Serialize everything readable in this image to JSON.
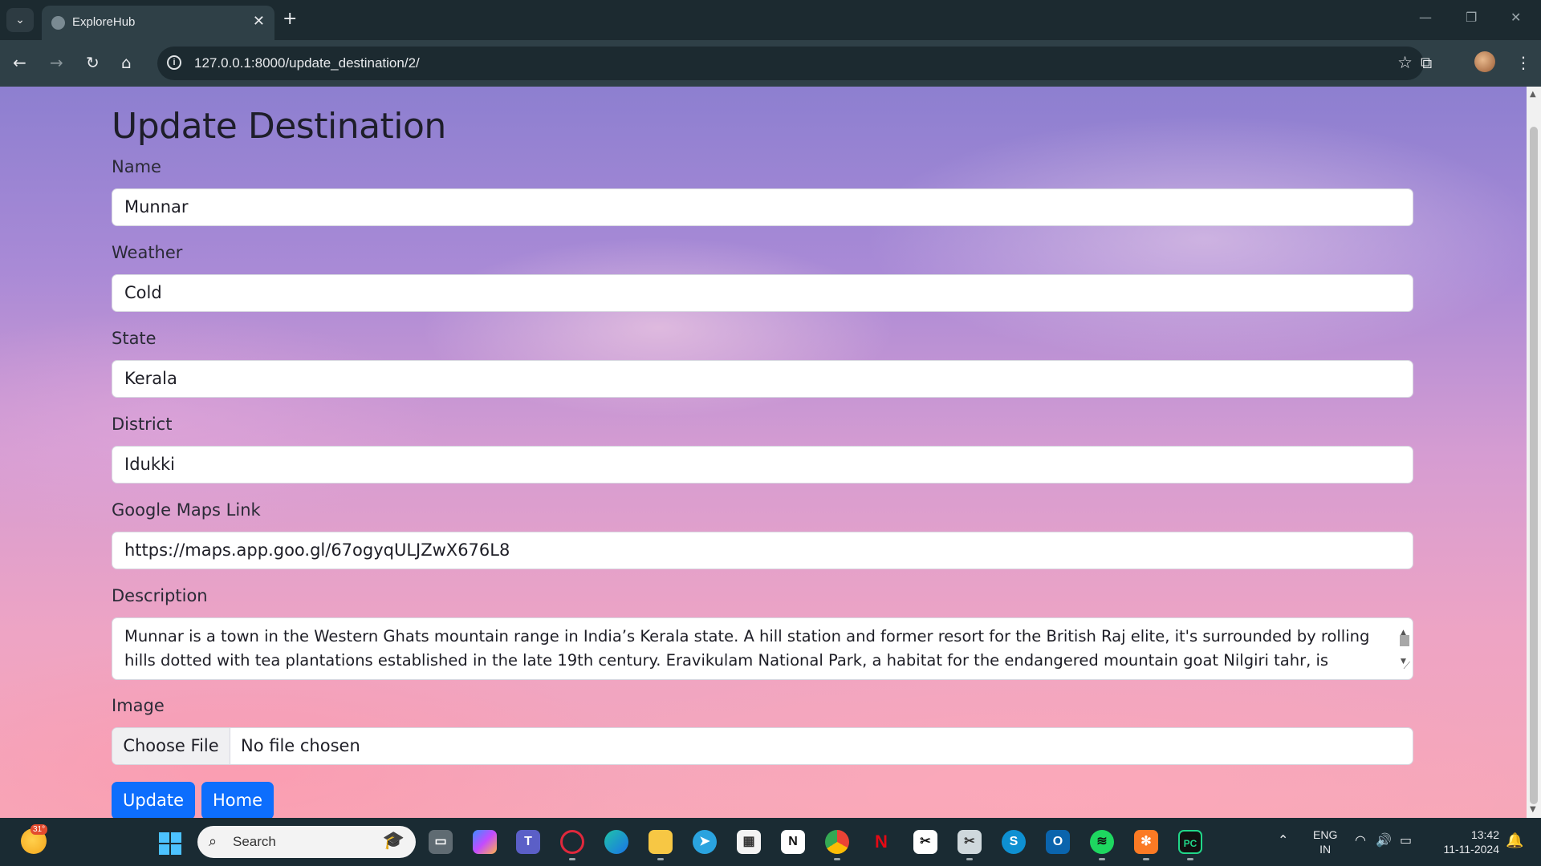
{
  "browser": {
    "tab_title": "ExploreHub",
    "url": "127.0.0.1:8000/update_destination/2/",
    "new_tab_symbol": "+",
    "close_tab_symbol": "✕"
  },
  "form": {
    "title": "Update Destination",
    "name_label": "Name",
    "name_value": "Munnar",
    "weather_label": "Weather",
    "weather_value": "Cold",
    "state_label": "State",
    "state_value": "Kerala",
    "district_label": "District",
    "district_value": "Idukki",
    "maps_label": "Google Maps Link",
    "maps_value": "https://maps.app.goo.gl/67ogyqULJZwX676L8",
    "description_label": "Description",
    "description_value": "Munnar is a town in the Western Ghats mountain range in India’s Kerala state. A hill station and former resort for the British Raj elite, it's surrounded by rolling hills dotted with tea plantations established in the late 19th century. Eravikulam National Park, a habitat for the endangered mountain goat Nilgiri tahr, is",
    "image_label": "Image",
    "choose_file_label": "Choose File",
    "no_file_label": "No file chosen",
    "update_button": "Update",
    "home_button": "Home"
  },
  "taskbar": {
    "weather_temp": "31°",
    "search_placeholder": "Search",
    "lang_line1": "ENG",
    "lang_line2": "IN",
    "time": "13:42",
    "date": "11-11-2024"
  },
  "colors": {
    "primary_button": "#0d6efd",
    "chrome_dark": "#1c2a30",
    "toolbar": "#2f4047"
  }
}
